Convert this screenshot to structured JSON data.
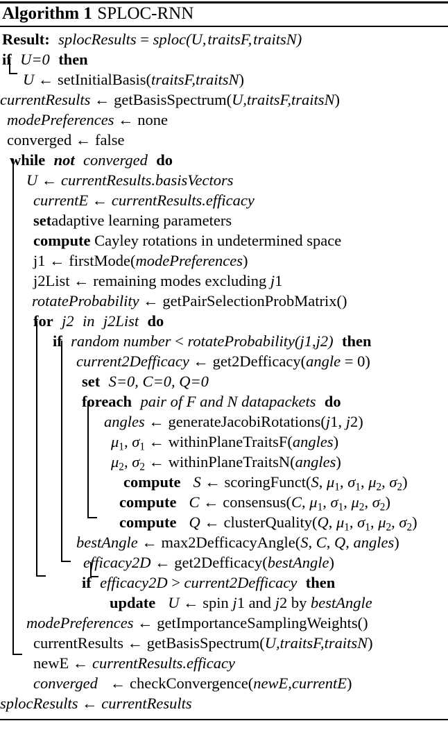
{
  "document": {
    "kind": "algorithm-float",
    "header": {
      "label": "Algorithm 1",
      "name": "SPLOC-RNN"
    },
    "result_keyword": "Result:",
    "result_expr": "splocResults = sploc(U, traitsF, traitsN)"
  },
  "lines": [
    {
      "id": "l01",
      "indent": 0,
      "text": "Result:  splocResults = sploc(U, traitsF, traitsN)"
    },
    {
      "id": "l02",
      "indent": 0,
      "text": "if  U=0  then"
    },
    {
      "id": "l03",
      "indent": 1,
      "text": "U ← setInitialBasis(traitsF,traitsN)"
    },
    {
      "id": "l04",
      "indent": 0,
      "text": "currentResults ← getBasisSpectrum(U,traitsF,traitsN)"
    },
    {
      "id": "l05",
      "indent": 0,
      "text": "modePreferences ← none"
    },
    {
      "id": "l06",
      "indent": 0,
      "text": "converged ← false"
    },
    {
      "id": "l07",
      "indent": 0,
      "text": "while not converged do"
    },
    {
      "id": "l08",
      "indent": 1,
      "text": "U ← currentResults.basisVectors"
    },
    {
      "id": "l09",
      "indent": 1,
      "text": "currentE ← currentResults.efficacy"
    },
    {
      "id": "l10",
      "indent": 1,
      "text": "setadaptive learning parameters"
    },
    {
      "id": "l11",
      "indent": 1,
      "text": "compute Cayley rotations in undetermined space"
    },
    {
      "id": "l12",
      "indent": 1,
      "text": "j1 ← firstMode(modePreferences)"
    },
    {
      "id": "l13",
      "indent": 1,
      "text": "j2List ← remaining modes excluding j1"
    },
    {
      "id": "l14",
      "indent": 1,
      "text": "rotateProbability ← getPairSelectionProbMatrix()"
    },
    {
      "id": "l15",
      "indent": 1,
      "text": "for j2 in j2List do"
    },
    {
      "id": "l16",
      "indent": 2,
      "text": "if random number < rotateProbability(j1,j2) then"
    },
    {
      "id": "l17",
      "indent": 3,
      "text": "current2Defficacy ← get2Defficacy(angle = 0)"
    },
    {
      "id": "l18",
      "indent": 3,
      "text": "set S=0, C=0, Q=0"
    },
    {
      "id": "l19",
      "indent": 3,
      "text": "foreach pair of F and N datapackets do"
    },
    {
      "id": "l20",
      "indent": 4,
      "text": "angles ← generateJacobiRotations(j1, j2)"
    },
    {
      "id": "l21",
      "indent": 4,
      "text": "μ1, σ1 ← withinPlaneTraitsF(angles)"
    },
    {
      "id": "l22",
      "indent": 4,
      "text": "μ2, σ2 ← withinPlaneTraitsN(angles)"
    },
    {
      "id": "l23",
      "indent": 4,
      "text": "compute  S ← scoringFunct(S, μ1, σ1, μ2, σ2)"
    },
    {
      "id": "l24",
      "indent": 4,
      "text": "compute  C ← consensus(C, μ1, σ1, μ2, σ2)"
    },
    {
      "id": "l25",
      "indent": 4,
      "text": "compute  Q ← clusterQuality(Q, μ1, σ1, μ2, σ2)"
    },
    {
      "id": "l26",
      "indent": 3,
      "text": "bestAngle ← max2DefficacyAngle(S, C, Q, angles)"
    },
    {
      "id": "l27",
      "indent": 3,
      "text": "efficacy2D ← get2Defficacy(bestAngle)"
    },
    {
      "id": "l28",
      "indent": 3,
      "text": "if efficacy2D > current2Defficacy then"
    },
    {
      "id": "l29",
      "indent": 4,
      "text": "update  U ← spin j1 and j2 by bestAngle"
    },
    {
      "id": "l30",
      "indent": 1,
      "text": "modePreferences ← getImportanceSamplingWeights()"
    },
    {
      "id": "l31",
      "indent": 1,
      "text": "currentResults ← getBasisSpectrum(U,traitsF,traitsN)"
    },
    {
      "id": "l32",
      "indent": 1,
      "text": "newE ← currentResults.efficacy"
    },
    {
      "id": "l33",
      "indent": 1,
      "text": "converged  ← checkConvergence(newE,currentE)"
    },
    {
      "id": "l34",
      "indent": 0,
      "text": "splocResults ← currentResults"
    }
  ],
  "keywords": [
    "Result:",
    "if",
    "then",
    "while",
    "not",
    "do",
    "for",
    "in",
    "foreach",
    "set",
    "compute",
    "update"
  ],
  "variables": [
    "splocResults",
    "sploc",
    "U",
    "traitsF",
    "traitsN",
    "currentResults",
    "modePreferences",
    "converged",
    "currentE",
    "j1",
    "j2",
    "j2List",
    "rotateProbability",
    "current2Defficacy",
    "angle",
    "S",
    "C",
    "Q",
    "angles",
    "bestAngle",
    "efficacy2D",
    "newE",
    "F",
    "N"
  ],
  "functions": [
    "sploc",
    "setInitialBasis",
    "getBasisSpectrum",
    "firstMode",
    "getPairSelectionProbMatrix",
    "get2Defficacy",
    "generateJacobiRotations",
    "withinPlaneTraitsF",
    "withinPlaneTraitsN",
    "scoringFunct",
    "consensus",
    "clusterQuality",
    "max2DefficacyAngle",
    "getImportanceSamplingWeights",
    "checkConvergence"
  ],
  "symbols": {
    "assign": "←",
    "less_than": "<",
    "greater_than": ">",
    "equals": "=",
    "mu": "μ",
    "sigma": "σ"
  },
  "colors": {
    "text": "#000000",
    "background": "#ffffff",
    "rule": "#000000"
  }
}
